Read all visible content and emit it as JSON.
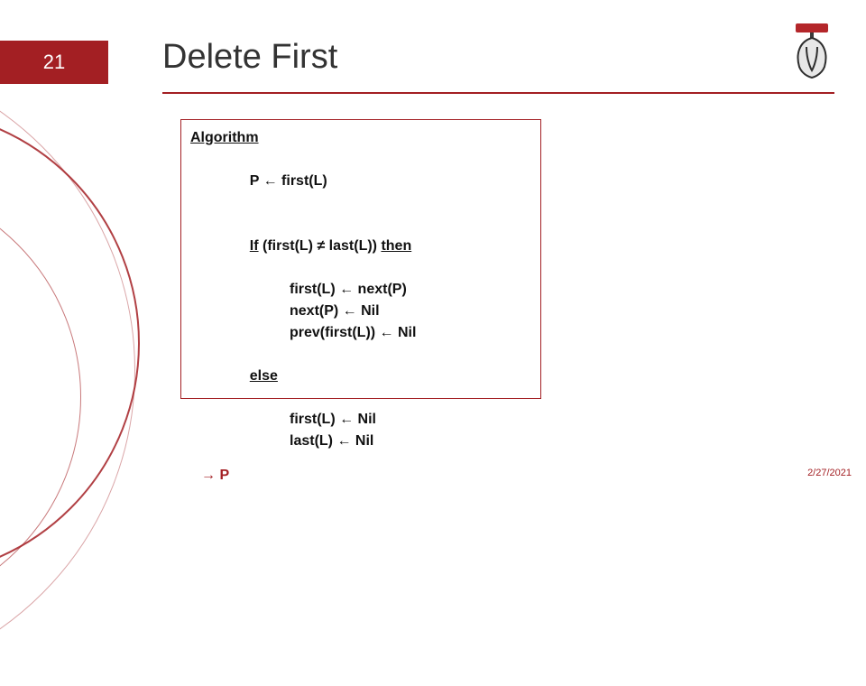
{
  "slide": {
    "number": "21",
    "title": "Delete First",
    "date": "2/27/2021"
  },
  "algo": {
    "heading": "Algorithm",
    "lines": {
      "assignP_lhs": "P ",
      "assignP_arrow": "←",
      "assignP_rhs": " first(L)",
      "if_kw": "If",
      "if_cond": " (first(L) ≠ last(L)) ",
      "then_kw": "then",
      "body1": "first(L) ← next(P)",
      "body2": "next(P) ← Nil",
      "body3": "prev(first(L)) ← Nil",
      "else_kw": "else",
      "else1": "first(L) ← Nil",
      "else2": "last(L) ← Nil",
      "ret_arrow": "→",
      "ret_val": " P"
    }
  },
  "icons": {
    "logo": "institution-logo"
  }
}
